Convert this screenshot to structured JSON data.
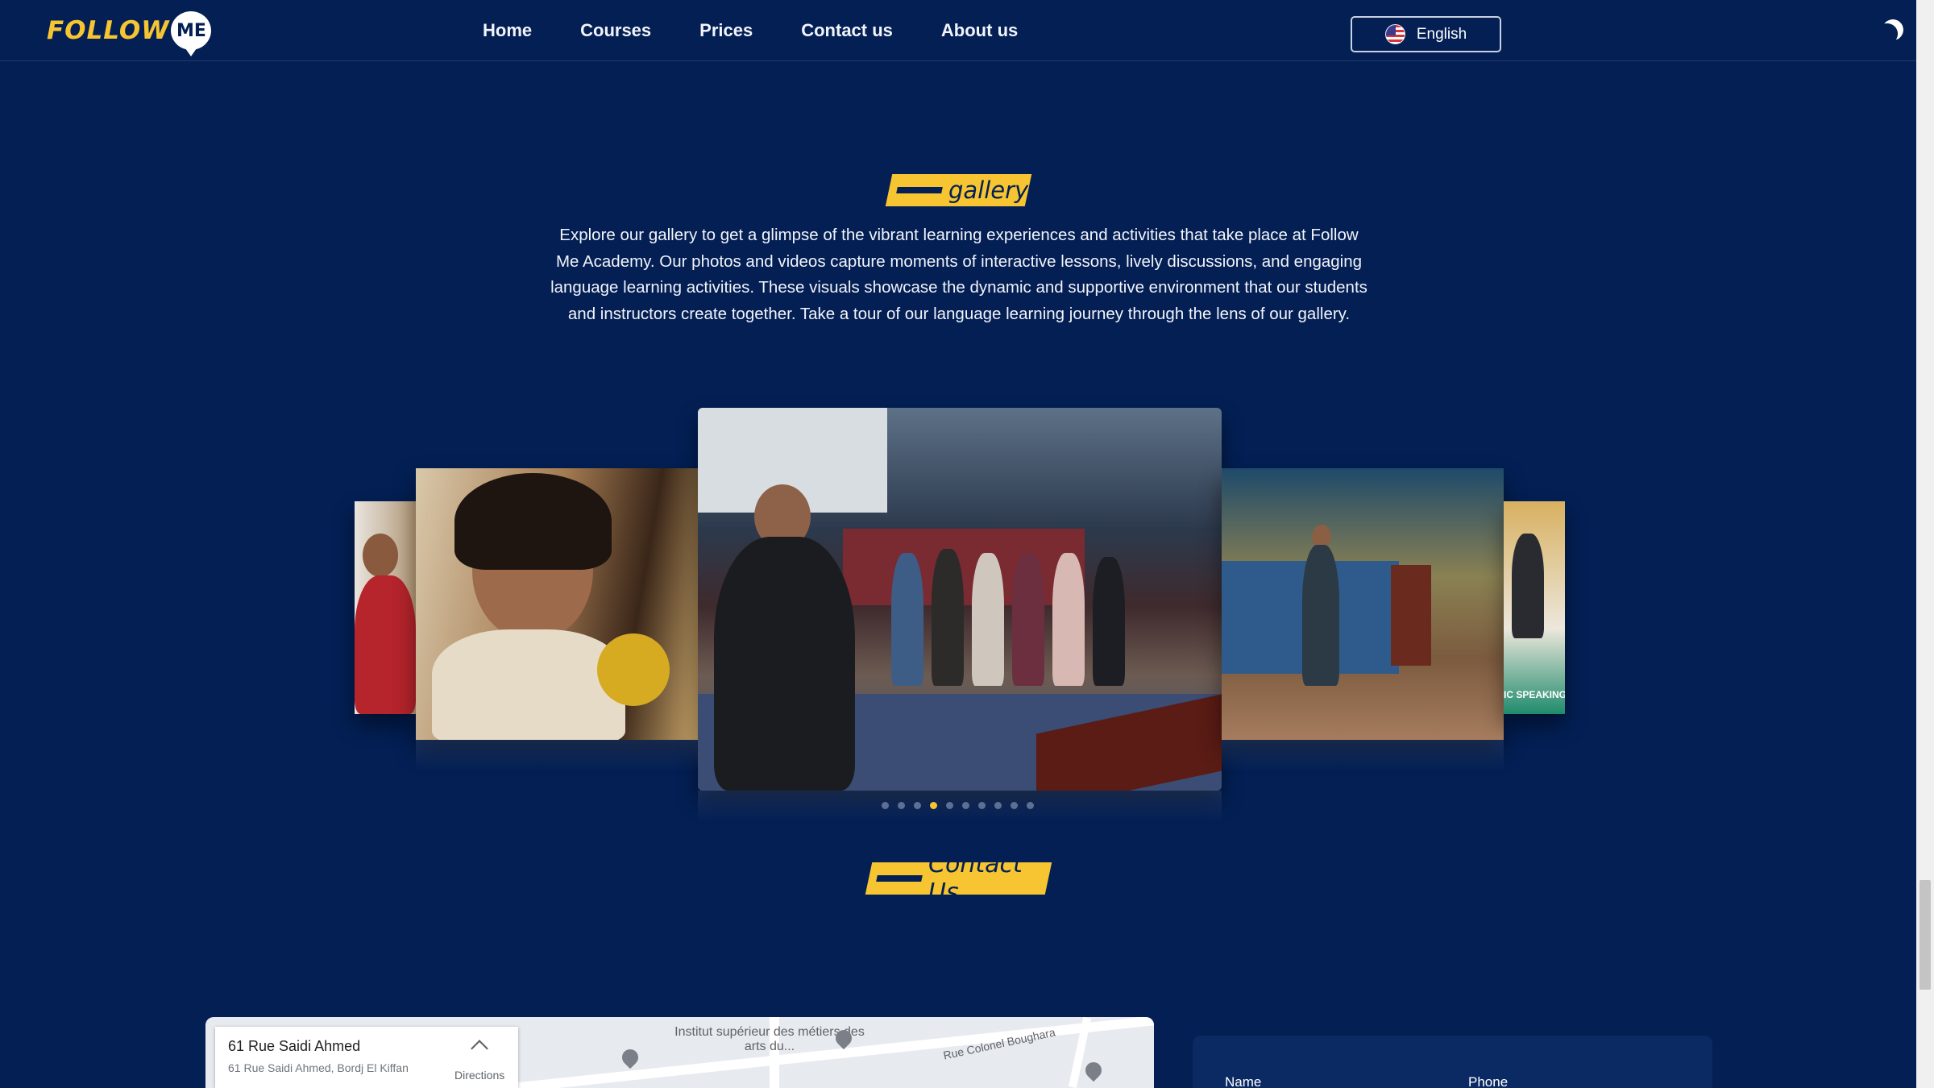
{
  "header": {
    "logo_text": "FOLLOW",
    "logo_bubble": "ME",
    "nav": [
      "Home",
      "Courses",
      "Prices",
      "Contact us",
      "About us"
    ],
    "language": "English",
    "language_flag": "us-flag-icon",
    "theme_toggle_icon": "moon-icon"
  },
  "gallery": {
    "title": "gallery",
    "description": "Explore our gallery to get a glimpse of the vibrant learning experiences and activities that take place at Follow Me Academy. Our photos and videos capture moments of interactive lessons, lively discussions, and engaging language learning activities. These visuals showcase the dynamic and supportive environment that our students and instructors create together. Take a tour of our language learning journey through the lens of our gallery.",
    "slide_count": 10,
    "active_slide": 4,
    "visible_text_in_photo": "IC SPEAKING"
  },
  "contact": {
    "title": "Contact Us",
    "map": {
      "place_title": "61 Rue Saidi Ahmed",
      "place_address": "61 Rue Saidi Ahmed, Bordj El Kiffan",
      "directions_label": "Directions",
      "labels": [
        "Institut supérieur des métiers des arts du...",
        "Rue Colonel Boughara"
      ]
    },
    "form": {
      "name_label": "Name",
      "phone_label": "Phone"
    }
  },
  "colors": {
    "background": "#031f54",
    "accent": "#f6c531"
  }
}
